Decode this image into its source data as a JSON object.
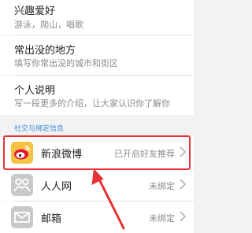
{
  "profile_fields": [
    {
      "title": "兴趣爱好",
      "subtitle": "游泳，爬山，唱歌"
    },
    {
      "title": "常出没的地方",
      "subtitle": "填写你常出没的城市和街区"
    },
    {
      "title": "个人说明",
      "subtitle": "写一段更多的介绍，让大家认识你了解你"
    }
  ],
  "section_label": "社交与绑定信息",
  "accounts": [
    {
      "name": "新浪微博",
      "status": "已开启好友推荐",
      "icon": "weibo-icon"
    },
    {
      "name": "人人网",
      "status": "未绑定",
      "icon": "renren-icon"
    },
    {
      "name": "邮箱",
      "status": "未绑定",
      "icon": "mail-icon"
    }
  ],
  "colors": {
    "highlight": "#e63234",
    "section_label": "#3e8ed8"
  }
}
